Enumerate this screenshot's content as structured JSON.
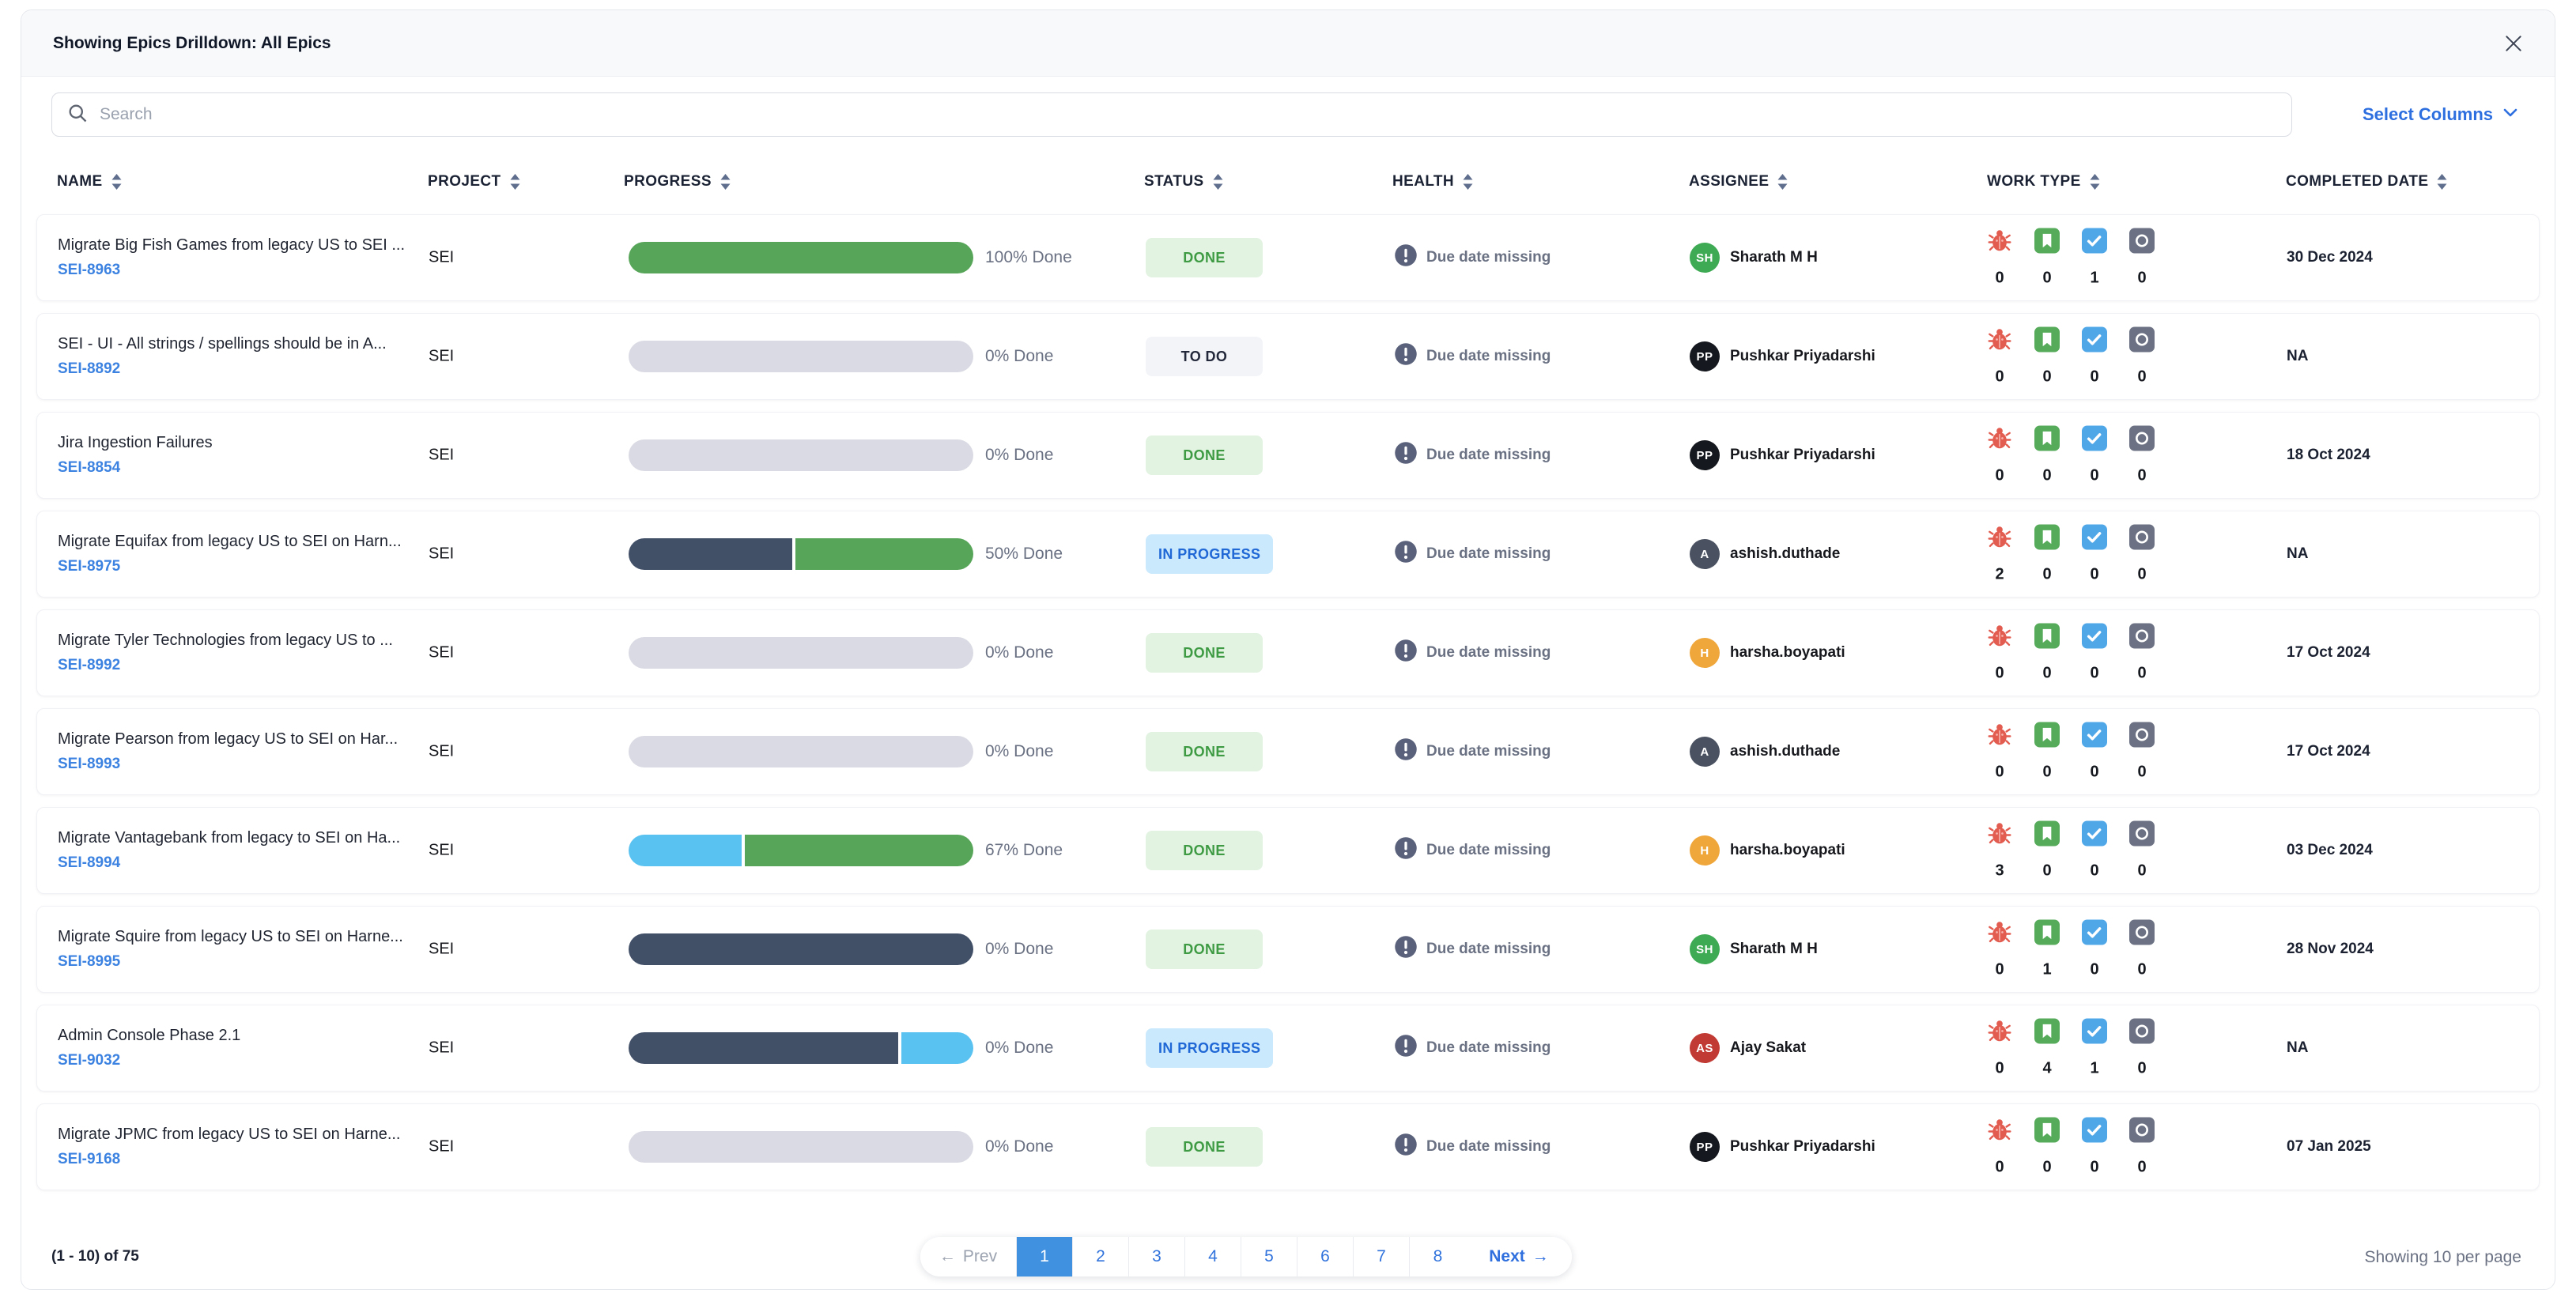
{
  "modal": {
    "title": "Showing Epics Drilldown: All Epics"
  },
  "toolbar": {
    "search_placeholder": "Search",
    "select_columns_label": "Select Columns"
  },
  "icons": {
    "close": "x-cross",
    "search": "magnifier",
    "sort": "up-down-arrows",
    "select_columns_chevron": "chevron-down",
    "health": "exclamation-circle",
    "work_types": [
      "bug",
      "story",
      "task",
      "epic"
    ],
    "prev_arrow": "←",
    "next_arrow": "→"
  },
  "colors": {
    "progress": {
      "green": "#57a558",
      "slate": "#414f67",
      "blue": "#59c2f0",
      "gray": "#d9dae3"
    },
    "avatars": {
      "green": "#3faa54",
      "black": "#15181e",
      "darkgray": "#4a5160",
      "amber": "#efa73c",
      "red": "#c13a33"
    },
    "accent_blue": "#2e6fe0",
    "active_page_blue": "#4191e1"
  },
  "table": {
    "columns": [
      {
        "label": "NAME"
      },
      {
        "label": "PROJECT"
      },
      {
        "label": "PROGRESS"
      },
      {
        "label": "STATUS"
      },
      {
        "label": "HEALTH"
      },
      {
        "label": "ASSIGNEE"
      },
      {
        "label": "WORK TYPE"
      },
      {
        "label": "COMPLETED DATE"
      }
    ],
    "rows": [
      {
        "name": "Migrate Big Fish Games from legacy US to SEI ...",
        "key": "SEI-8963",
        "project": "SEI",
        "progress": {
          "segments": [
            {
              "color": "green",
              "fraction": 1
            }
          ],
          "label": "100% Done"
        },
        "status": {
          "label": "DONE",
          "type": "done"
        },
        "health": "Due date missing",
        "assignee": {
          "initials": "SH",
          "color": "green",
          "name": "Sharath M H"
        },
        "work_type_counts": [
          "0",
          "0",
          "1",
          "0"
        ],
        "completed_date": "30 Dec 2024"
      },
      {
        "name": "SEI - UI - All strings / spellings should be in A...",
        "key": "SEI-8892",
        "project": "SEI",
        "progress": {
          "segments": [
            {
              "color": "gray",
              "fraction": 1
            }
          ],
          "label": "0% Done"
        },
        "status": {
          "label": "TO DO",
          "type": "todo"
        },
        "health": "Due date missing",
        "assignee": {
          "initials": "PP",
          "color": "black",
          "name": "Pushkar Priyadarshi"
        },
        "work_type_counts": [
          "0",
          "0",
          "0",
          "0"
        ],
        "completed_date": "NA"
      },
      {
        "name": "Jira Ingestion Failures",
        "key": "SEI-8854",
        "project": "SEI",
        "progress": {
          "segments": [
            {
              "color": "gray",
              "fraction": 1
            }
          ],
          "label": "0% Done"
        },
        "status": {
          "label": "DONE",
          "type": "done"
        },
        "health": "Due date missing",
        "assignee": {
          "initials": "PP",
          "color": "black",
          "name": "Pushkar Priyadarshi"
        },
        "work_type_counts": [
          "0",
          "0",
          "0",
          "0"
        ],
        "completed_date": "18 Oct 2024"
      },
      {
        "name": "Migrate Equifax from legacy US to SEI on Harn...",
        "key": "SEI-8975",
        "project": "SEI",
        "progress": {
          "segments": [
            {
              "color": "slate",
              "fraction": 0.48
            },
            {
              "color": "green",
              "fraction": 0.52
            }
          ],
          "label": "50% Done"
        },
        "status": {
          "label": "IN PROGRESS",
          "type": "inprogress"
        },
        "health": "Due date missing",
        "assignee": {
          "initials": "A",
          "color": "darkgray",
          "name": "ashish.duthade"
        },
        "work_type_counts": [
          "2",
          "0",
          "0",
          "0"
        ],
        "completed_date": "NA"
      },
      {
        "name": "Migrate Tyler Technologies from legacy US to ...",
        "key": "SEI-8992",
        "project": "SEI",
        "progress": {
          "segments": [
            {
              "color": "gray",
              "fraction": 1
            }
          ],
          "label": "0% Done"
        },
        "status": {
          "label": "DONE",
          "type": "done"
        },
        "health": "Due date missing",
        "assignee": {
          "initials": "H",
          "color": "amber",
          "name": "harsha.boyapati"
        },
        "work_type_counts": [
          "0",
          "0",
          "0",
          "0"
        ],
        "completed_date": "17 Oct 2024"
      },
      {
        "name": "Migrate Pearson from legacy US to SEI on Har...",
        "key": "SEI-8993",
        "project": "SEI",
        "progress": {
          "segments": [
            {
              "color": "gray",
              "fraction": 1
            }
          ],
          "label": "0% Done"
        },
        "status": {
          "label": "DONE",
          "type": "done"
        },
        "health": "Due date missing",
        "assignee": {
          "initials": "A",
          "color": "darkgray",
          "name": "ashish.duthade"
        },
        "work_type_counts": [
          "0",
          "0",
          "0",
          "0"
        ],
        "completed_date": "17 Oct 2024"
      },
      {
        "name": "Migrate Vantagebank from legacy to SEI on Ha...",
        "key": "SEI-8994",
        "project": "SEI",
        "progress": {
          "segments": [
            {
              "color": "blue",
              "fraction": 0.33
            },
            {
              "color": "green",
              "fraction": 0.67
            }
          ],
          "label": "67% Done"
        },
        "status": {
          "label": "DONE",
          "type": "done"
        },
        "health": "Due date missing",
        "assignee": {
          "initials": "H",
          "color": "amber",
          "name": "harsha.boyapati"
        },
        "work_type_counts": [
          "3",
          "0",
          "0",
          "0"
        ],
        "completed_date": "03 Dec 2024"
      },
      {
        "name": "Migrate Squire from legacy US to SEI on Harne...",
        "key": "SEI-8995",
        "project": "SEI",
        "progress": {
          "segments": [
            {
              "color": "slate",
              "fraction": 1
            }
          ],
          "label": "0% Done"
        },
        "status": {
          "label": "DONE",
          "type": "done"
        },
        "health": "Due date missing",
        "assignee": {
          "initials": "SH",
          "color": "green",
          "name": "Sharath M H"
        },
        "work_type_counts": [
          "0",
          "1",
          "0",
          "0"
        ],
        "completed_date": "28 Nov 2024"
      },
      {
        "name": "Admin Console Phase 2.1",
        "key": "SEI-9032",
        "project": "SEI",
        "progress": {
          "segments": [
            {
              "color": "slate",
              "fraction": 0.79
            },
            {
              "color": "blue",
              "fraction": 0.21
            }
          ],
          "label": "0% Done"
        },
        "status": {
          "label": "IN PROGRESS",
          "type": "inprogress"
        },
        "health": "Due date missing",
        "assignee": {
          "initials": "AS",
          "color": "red",
          "name": "Ajay Sakat"
        },
        "work_type_counts": [
          "0",
          "4",
          "1",
          "0"
        ],
        "completed_date": "NA"
      },
      {
        "name": "Migrate JPMC from legacy US to SEI on Harne...",
        "key": "SEI-9168",
        "project": "SEI",
        "progress": {
          "segments": [
            {
              "color": "gray",
              "fraction": 1
            }
          ],
          "label": "0% Done"
        },
        "status": {
          "label": "DONE",
          "type": "done"
        },
        "health": "Due date missing",
        "assignee": {
          "initials": "PP",
          "color": "black",
          "name": "Pushkar Priyadarshi"
        },
        "work_type_counts": [
          "0",
          "0",
          "0",
          "0"
        ],
        "completed_date": "07 Jan 2025"
      }
    ]
  },
  "pagination": {
    "range_label": "(1 - 10) of 75",
    "prev_label": "Prev",
    "next_label": "Next",
    "pages": [
      "1",
      "2",
      "3",
      "4",
      "5",
      "6",
      "7",
      "8"
    ],
    "active_page": "1",
    "per_page_label": "Showing 10 per page"
  }
}
